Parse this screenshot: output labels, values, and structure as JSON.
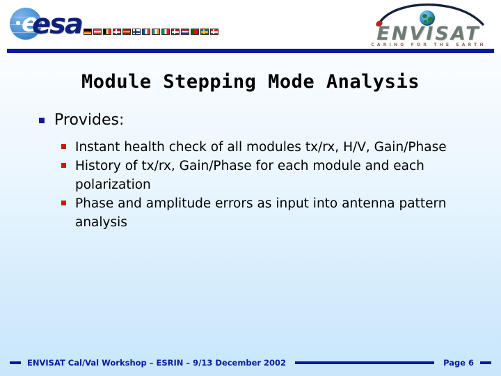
{
  "slide": {
    "title": "Module Stepping Mode Analysis",
    "background_top": "#ffffff",
    "background_bottom": "#c9e6fb",
    "accent_blue": "#0b1a9c",
    "bullet_blue": "#1414aa",
    "bullet_red": "#d01414"
  },
  "header": {
    "esa_logo": {
      "wordmark": "esa",
      "globe_glyph": "e",
      "flags": [
        {
          "name": "germany",
          "title": "Germany"
        },
        {
          "name": "austria",
          "title": "Austria"
        },
        {
          "name": "belgium",
          "title": "Belgium"
        },
        {
          "name": "denmark",
          "title": "Denmark"
        },
        {
          "name": "spain",
          "title": "Spain"
        },
        {
          "name": "finland",
          "title": "Finland"
        },
        {
          "name": "france",
          "title": "France"
        },
        {
          "name": "ireland",
          "title": "Ireland"
        },
        {
          "name": "italy",
          "title": "Italy"
        },
        {
          "name": "norway",
          "title": "Norway"
        },
        {
          "name": "netherlands",
          "title": "Netherlands"
        },
        {
          "name": "portugal",
          "title": "Portugal"
        },
        {
          "name": "sweden",
          "title": "Sweden"
        },
        {
          "name": "switzerland",
          "title": "Switzerland"
        }
      ]
    },
    "envisat_logo": {
      "wordmark": "ENVISAT",
      "tagline": "CARING FOR THE EARTH"
    }
  },
  "content": {
    "bullets": [
      {
        "label": "Provides:",
        "children": [
          "Instant health check of all modules tx/rx, H/V, Gain/Phase",
          "History of tx/rx, Gain/Phase for each module and each polarization",
          "Phase and amplitude errors as input into antenna pattern analysis"
        ]
      }
    ]
  },
  "footer": {
    "text": "ENVISAT Cal/Val Workshop – ESRIN – 9/13 December 2002",
    "page": "Page 6"
  }
}
